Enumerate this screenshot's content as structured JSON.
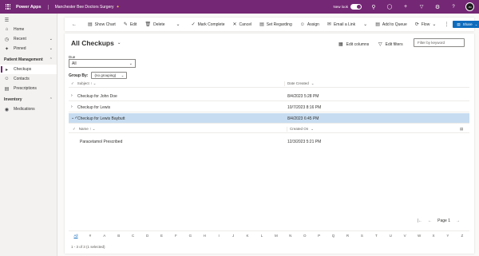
{
  "topbar": {
    "app_name": "Power Apps",
    "app_title": "Manchester Bee Doctors Surgery",
    "title_icon": "bee-icon",
    "new_look_label": "New look",
    "avatar_initials": "JM"
  },
  "sidebar": {
    "items_top": [
      {
        "label": "Home",
        "icon": "home-icon"
      },
      {
        "label": "Recent",
        "icon": "clock-icon"
      },
      {
        "label": "Pinned",
        "icon": "pin-icon"
      }
    ],
    "groups": [
      {
        "label": "Patient Management",
        "items": [
          "Checkups",
          "Contacts",
          "Prescriptions"
        ]
      },
      {
        "label": "Inventory",
        "items": [
          "Medications"
        ]
      }
    ],
    "active": "Checkups"
  },
  "commands": {
    "show_chart": "Show Chart",
    "edit": "Edit",
    "delete": "Delete",
    "mark_complete": "Mark Complete",
    "cancel": "Cancel",
    "set_regarding": "Set Regarding",
    "assign": "Assign",
    "email_link": "Email a Link",
    "add_to_queue": "Add to Queue",
    "flow": "Flow",
    "share": "Share"
  },
  "view": {
    "title": "All Checkups",
    "edit_columns": "Edit columns",
    "edit_filters": "Edit filters",
    "filter_placeholder": "Filter by keyword",
    "due_label": "Due",
    "due_value": "All",
    "group_by_label": "Group By:",
    "group_by_value": "(no grouping)"
  },
  "grid": {
    "columns": {
      "subject": "Subject",
      "date_created": "Date Created"
    },
    "rows": [
      {
        "subject": "Checkup for John Doe",
        "date": "8/4/2023 5:28 PM"
      },
      {
        "subject": "Checkup for Lewis",
        "date": "10/7/2023 8:16 PM"
      },
      {
        "subject": "Checkup for Lewis Baybutt",
        "date": "8/4/2023 6:45 PM"
      }
    ],
    "subgrid": {
      "columns": {
        "name": "Name",
        "created_on": "Created On"
      },
      "row": {
        "name": "Paracetamol Prescribed",
        "date": "12/3/2023 5:21 PM"
      }
    }
  },
  "pager": {
    "page_label": "Page 1"
  },
  "jumpbar": [
    "All",
    "#",
    "A",
    "B",
    "C",
    "D",
    "E",
    "F",
    "G",
    "H",
    "I",
    "J",
    "K",
    "L",
    "M",
    "N",
    "O",
    "P",
    "Q",
    "R",
    "S",
    "T",
    "U",
    "V",
    "W",
    "X",
    "Y",
    "Z"
  ],
  "status": "1 - 3 of 3 (1 selected)"
}
